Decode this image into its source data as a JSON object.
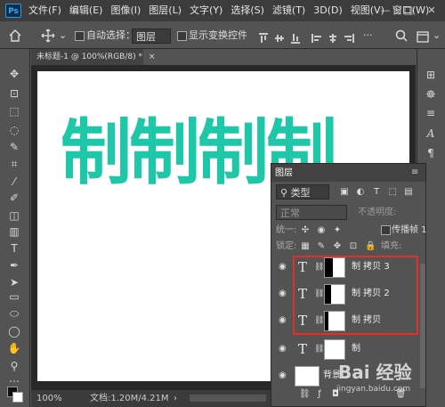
{
  "app": {
    "logo": "Ps"
  },
  "menu": [
    "文件(F)",
    "编辑(E)",
    "图像(I)",
    "图层(L)",
    "文字(Y)",
    "选择(S)",
    "滤镜(T)",
    "3D(D)",
    "视图(V)",
    "窗口(W)"
  ],
  "window_controls": {
    "minimize": "—",
    "restore": "□",
    "close": "✕"
  },
  "options": {
    "auto_select_label": "自动选择：",
    "auto_select_value": "图层",
    "transform_label": "显示变换控件"
  },
  "document": {
    "tab_label": "未标题-1 @ 100%(RGB/8) *",
    "close": "×",
    "canvas_text": [
      "制",
      "制",
      "制",
      "制"
    ],
    "canvas_color": "#1dc7a8"
  },
  "status": {
    "zoom": "100%",
    "doc_size": "文档:1.20M/4.21M"
  },
  "layers_panel": {
    "tab": "图层",
    "filter_value": "类型",
    "blend_mode": "正常",
    "opacity_label": "不透明度:",
    "unify_label": "统一:",
    "propagate_label": "传播帧 1",
    "lock_label": "锁定:",
    "fill_label": "填充:",
    "layers": [
      {
        "name": "制 拷贝 3",
        "type": "text",
        "has_mask": true
      },
      {
        "name": "制 拷贝 2",
        "type": "text",
        "has_mask": true
      },
      {
        "name": "制 拷贝",
        "type": "text",
        "has_mask": true
      },
      {
        "name": "制",
        "type": "text",
        "has_mask": true
      },
      {
        "name": "背景",
        "type": "image",
        "has_mask": false
      }
    ],
    "highlight_color": "#e0302d"
  },
  "watermark": {
    "main": "Bai 经验",
    "sub": "jingyan.baidu.com"
  }
}
